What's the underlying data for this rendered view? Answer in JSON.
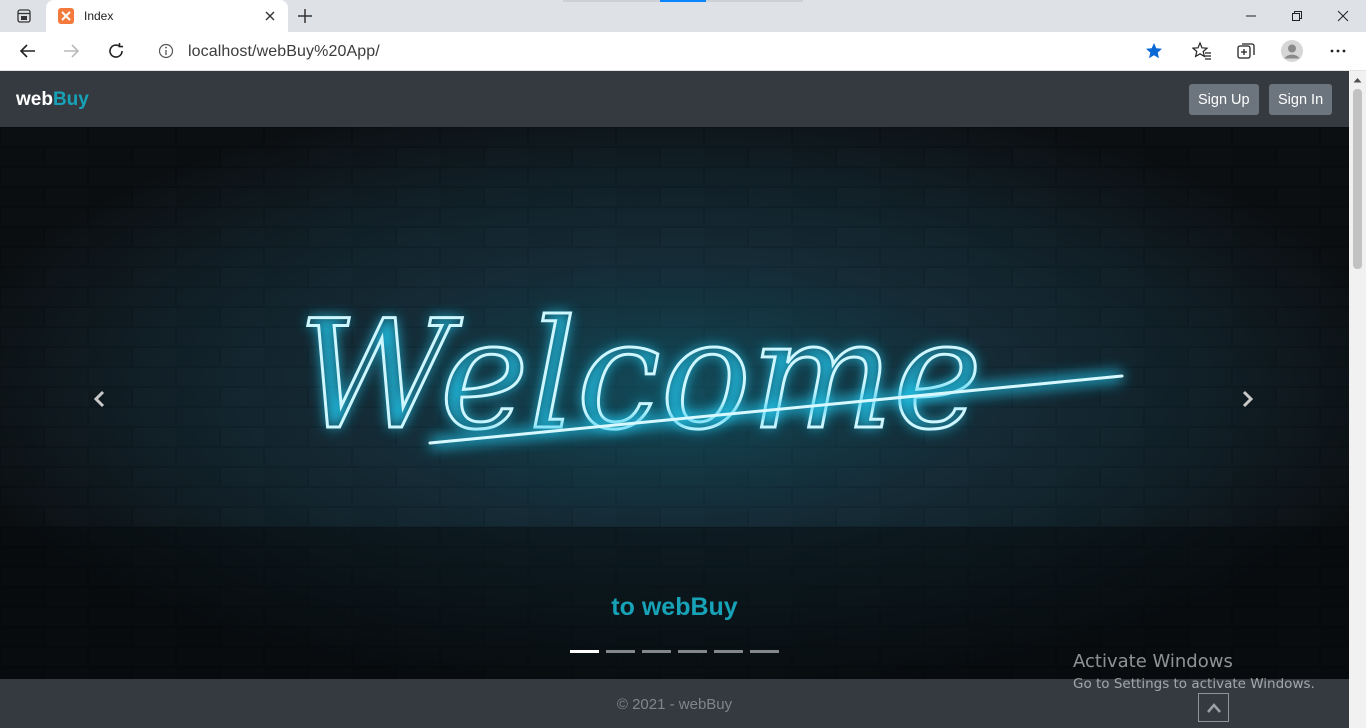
{
  "browser": {
    "tab_title": "Index",
    "url": "localhost/webBuy%20App/",
    "icons": {
      "tab_actions": "tab-actions-icon",
      "favicon": "xampp-favicon",
      "close": "close-icon",
      "new_tab": "plus-icon",
      "back": "back-arrow-icon",
      "forward": "forward-arrow-icon",
      "refresh": "refresh-icon",
      "info": "info-icon",
      "favorite": "star-icon",
      "favorites_menu": "favorites-icon",
      "collections": "collections-icon",
      "profile": "profile-icon",
      "more": "more-icon",
      "minimize": "minimize-icon",
      "restore": "restore-icon"
    }
  },
  "navbar": {
    "brand_part1": "web",
    "brand_part2": "Buy",
    "signup_label": "Sign Up",
    "signin_label": "Sign In"
  },
  "carousel": {
    "neon_text": "Welcome",
    "caption": "to webBuy",
    "slide_count": 6,
    "active_slide": 1
  },
  "footer": {
    "text": "© 2021 - webBuy"
  },
  "windows_watermark": {
    "title": "Activate Windows",
    "subtitle": "Go to Settings to activate Windows."
  },
  "colors": {
    "accent": "#17a2b8",
    "navbar_bg": "#343a40",
    "button_bg": "#6c757d",
    "neon": "#3fe0ff"
  }
}
